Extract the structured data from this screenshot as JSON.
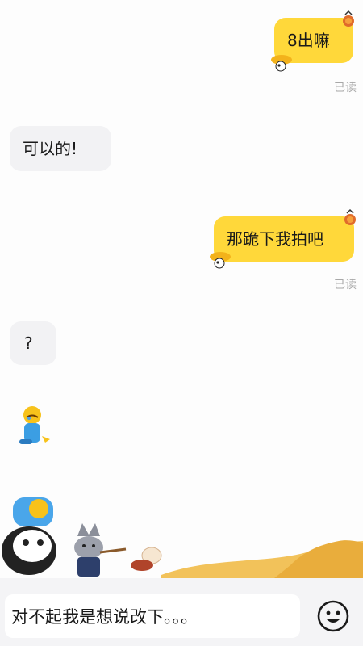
{
  "messages": [
    {
      "side": "out",
      "text": "8出嘛",
      "status": "已读"
    },
    {
      "side": "in",
      "text": "可以的!"
    },
    {
      "side": "out",
      "text": "那跪下我拍吧",
      "status": "已读"
    },
    {
      "side": "in",
      "text": "?"
    },
    {
      "side": "in",
      "sticker": "kneeling-crying-character"
    }
  ],
  "input": {
    "value": "对不起我是想说改下。。。"
  },
  "icons": {
    "emoji_button": "smiley-icon",
    "bubble_deco": "duck-hat-icon"
  },
  "colors": {
    "outgoing_bubble": "#ffd83a",
    "incoming_bubble": "#f2f2f4",
    "read_status": "#a8a8a8"
  }
}
